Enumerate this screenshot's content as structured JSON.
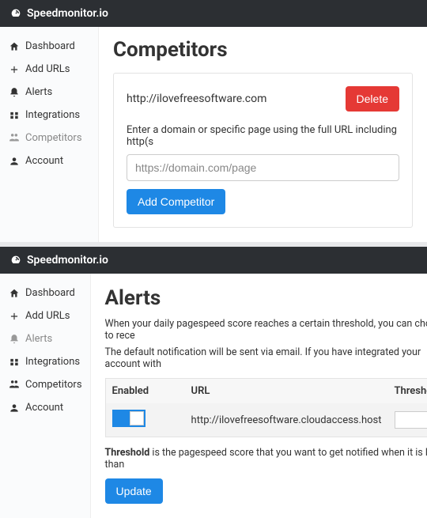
{
  "brand": "Speedmonitor.io",
  "nav": {
    "dashboard": "Dashboard",
    "add_urls": "Add URLs",
    "alerts": "Alerts",
    "integrations": "Integrations",
    "competitors": "Competitors",
    "account": "Account"
  },
  "competitors": {
    "title": "Competitors",
    "entry_url": "http://ilovefreesoftware.com",
    "delete_label": "Delete",
    "helper_text": "Enter a domain or specific page using the full URL including http(s",
    "input_placeholder": "https://domain.com/page",
    "add_label": "Add Competitor"
  },
  "alerts": {
    "title": "Alerts",
    "desc1": "When your daily pagespeed score reaches a certain threshold, you can choose to rece",
    "desc2": "The default notification will be sent via email. If you have integrated your account with",
    "col_enabled": "Enabled",
    "col_url": "URL",
    "col_threshold": "Threshold",
    "row_url": "http://ilovefreesoftware.cloudaccess.host",
    "note_bold": "Threshold",
    "note_rest": " is the pagespeed score that you want to get notified when it is lower than",
    "update_label": "Update"
  }
}
